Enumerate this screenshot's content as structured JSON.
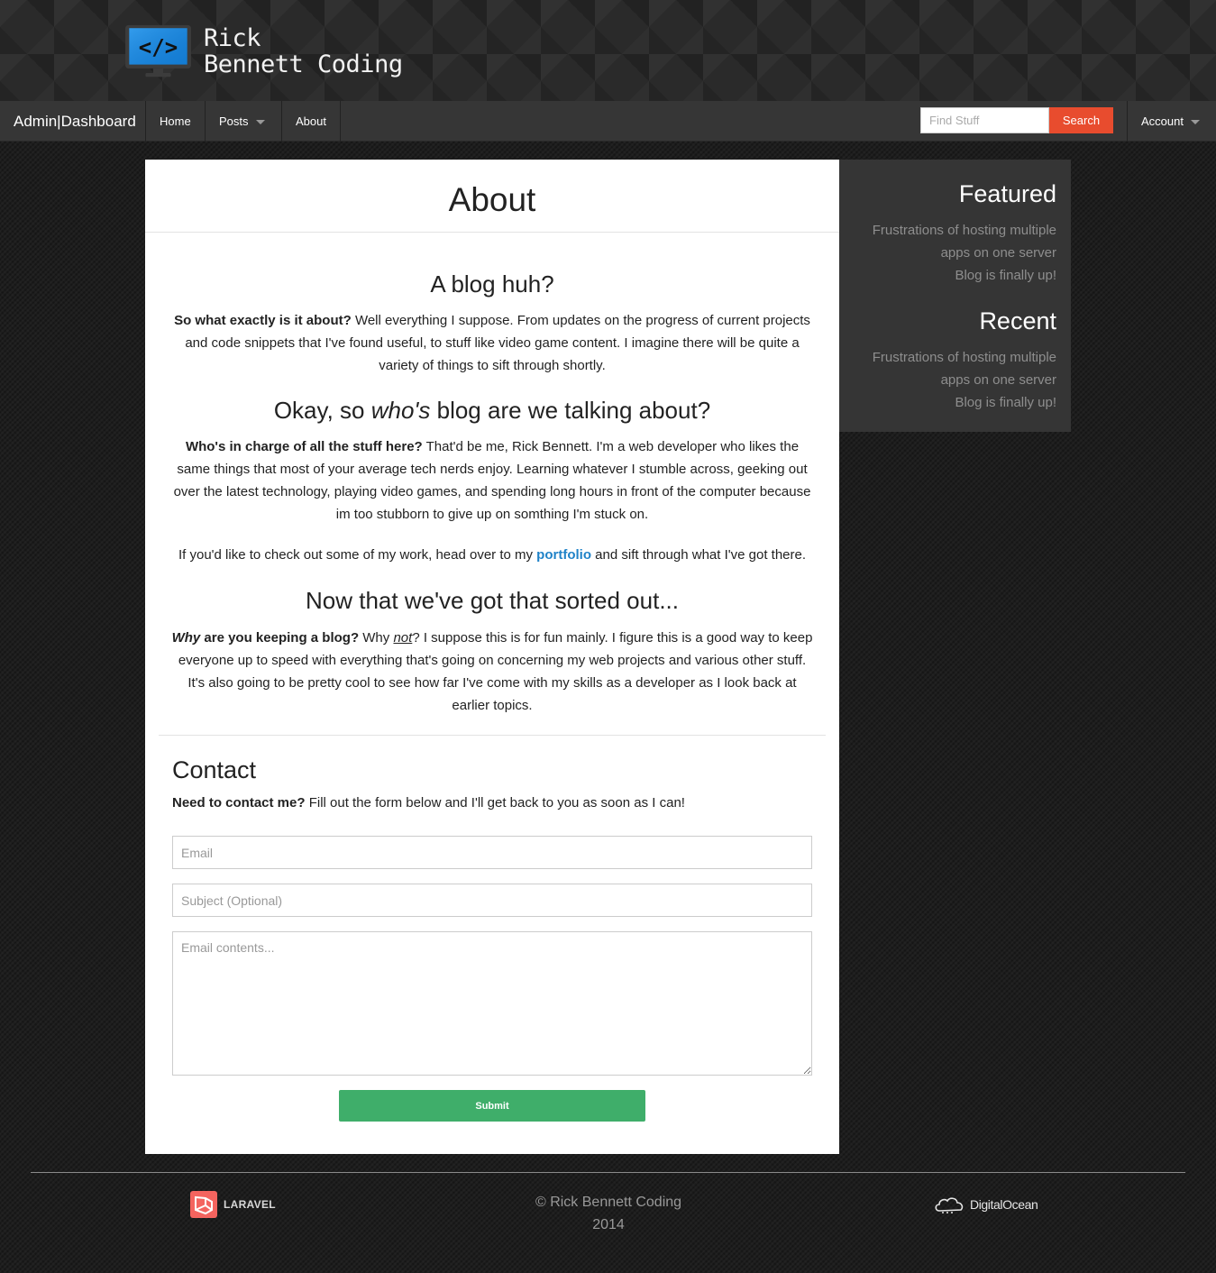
{
  "site": {
    "logo_line1": "Rick",
    "logo_line2": "Bennett Coding"
  },
  "navbar": {
    "brand": "Admin|Dashboard",
    "items": [
      {
        "label": "Home"
      },
      {
        "label": "Posts",
        "dropdown": true
      },
      {
        "label": "About"
      }
    ],
    "search_placeholder": "Find Stuff",
    "search_button": "Search",
    "account_label": "Account"
  },
  "main": {
    "title": "About",
    "sections": [
      {
        "heading": "A blog huh?",
        "paragraph_bold": "So what exactly is it about?",
        "paragraph_text": " Well everything I suppose. From updates on the progress of current projects and code snippets that I've found useful, to stuff like video game content. I imagine there will be quite a variety of things to sift through shortly."
      },
      {
        "heading_pre": "Okay, so ",
        "heading_em": "who's",
        "heading_post": " blog are we talking about?",
        "paragraph_bold": "Who's in charge of all the stuff here?",
        "paragraph_text": " That'd be me, Rick Bennett. I'm a web developer who likes the same things that most of your average tech nerds enjoy. Learning whatever I stumble across, geeking out over the latest technology, playing video games, and spending long hours in front of the computer because im too stubborn to give up on somthing I'm stuck on.",
        "portfolio_pre": "If you'd like to check out some of my work, head over to my ",
        "portfolio_link": "portfolio",
        "portfolio_post": " and sift through what I've got there."
      },
      {
        "heading": "Now that we've got that sorted out...",
        "bold_em": "Why",
        "bold_rest": " are you keeping a blog?",
        "text_pre": " Why ",
        "text_em": "not",
        "paragraph_text": "? I suppose this is for fun mainly. I figure this is a good way to keep everyone up to speed with everything that's going on concerning my web projects and various other stuff. It's also going to be pretty cool to see how far I've come with my skills as a developer as I look back at earlier topics."
      }
    ]
  },
  "contact": {
    "heading": "Contact",
    "intro_bold": "Need to contact me?",
    "intro_text": " Fill out the form below and I'll get back to you as soon as I can!",
    "email_placeholder": "Email",
    "subject_placeholder": "Subject (Optional)",
    "body_placeholder": "Email contents...",
    "submit_label": "Submit"
  },
  "sidebar": {
    "featured_heading": "Featured",
    "featured_links": [
      "Frustrations of hosting multiple apps on one server",
      "Blog is finally up!"
    ],
    "recent_heading": "Recent",
    "recent_links": [
      "Frustrations of hosting multiple apps on one server",
      "Blog is finally up!"
    ]
  },
  "footer": {
    "copyright_line1": "© Rick Bennett Coding",
    "copyright_line2": "2014",
    "laravel_label": "LARAVEL",
    "digitalocean_label": "DigitalOcean"
  },
  "colors": {
    "accent_search": "#e84c2e",
    "submit_green": "#3fae6a",
    "link_blue": "#2083c8"
  }
}
